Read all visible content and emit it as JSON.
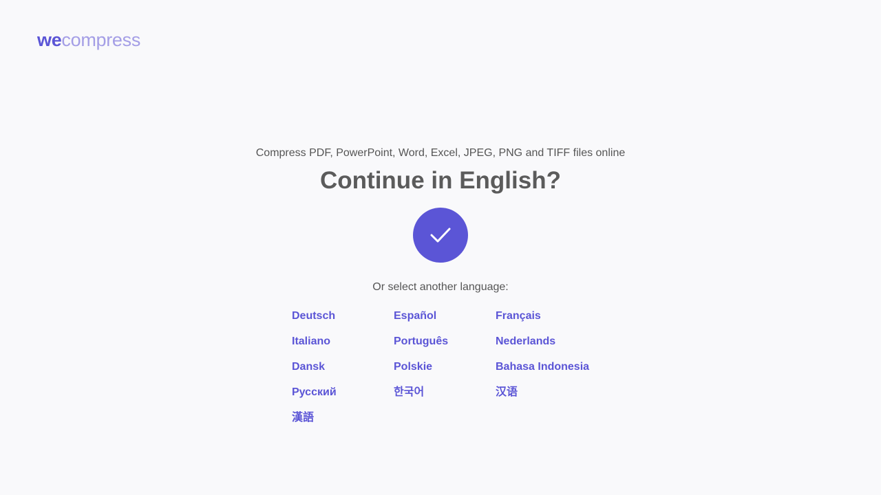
{
  "logo": {
    "part1": "we",
    "part2": "compress"
  },
  "subtitle": "Compress PDF, PowerPoint, Word, Excel, JPEG, PNG and TIFF files online",
  "title": "Continue in English?",
  "confirm": {
    "icon": "checkmark-icon"
  },
  "or_select": "Or select another language:",
  "languages": [
    "Deutsch",
    "Español",
    "Français",
    "Italiano",
    "Português",
    "Nederlands",
    "Dansk",
    "Polskie",
    "Bahasa Indonesia",
    "Русский",
    "한국어",
    "汉语",
    "漢語"
  ],
  "colors": {
    "accent": "#5b55d6",
    "accent_light": "#a49ee6",
    "background": "#f9f9fb",
    "text": "#555555"
  }
}
